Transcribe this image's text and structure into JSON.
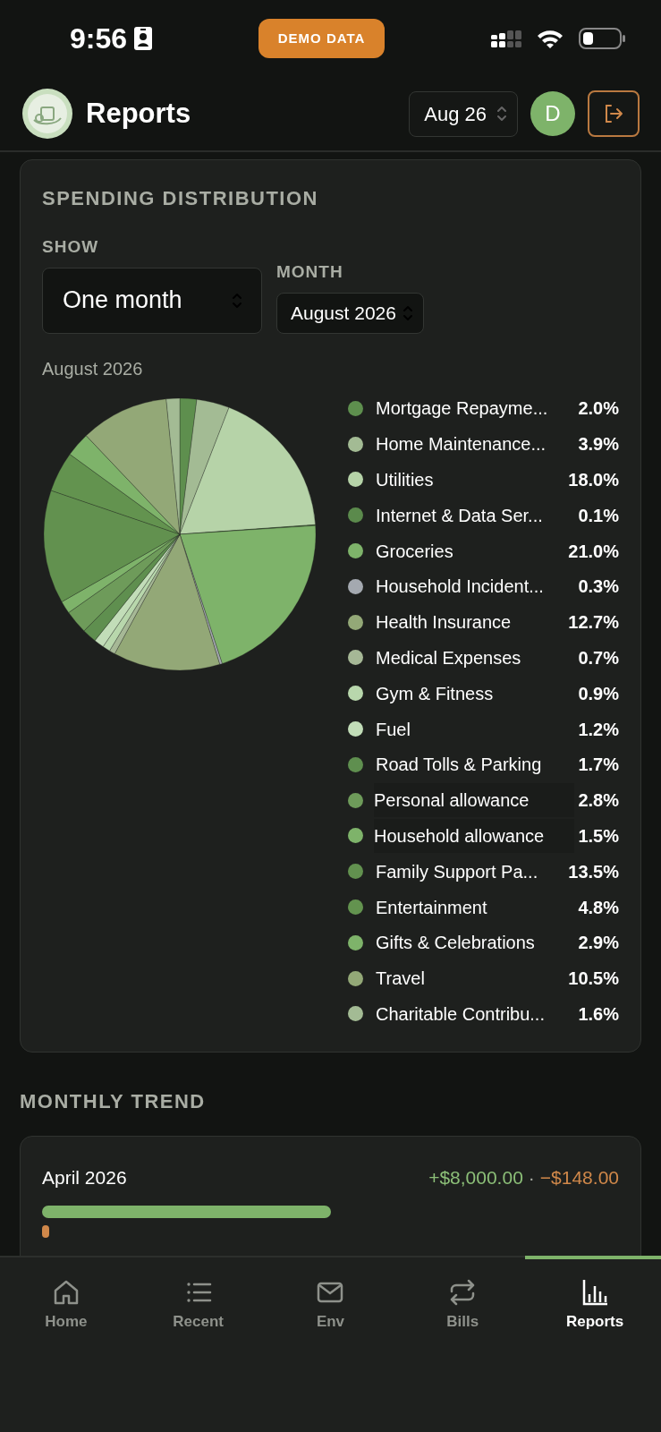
{
  "status_bar": {
    "time": "9:56",
    "badge": "DEMO DATA"
  },
  "header": {
    "title": "Reports",
    "period": "Aug 26",
    "avatar": "D"
  },
  "spending_distribution": {
    "title": "SPENDING DISTRIBUTION",
    "show": {
      "label": "SHOW",
      "value": "One month"
    },
    "month": {
      "label": "MONTH",
      "value": "August 2026"
    },
    "chart_data": {
      "type": "pie",
      "title": "August 2026",
      "categories": [
        "Mortgage Repayme...",
        "Home Maintenance...",
        "Utilities",
        "Internet & Data Ser...",
        "Groceries",
        "Household Incident...",
        "Health Insurance",
        "Medical Expenses",
        "Gym & Fitness",
        "Fuel",
        "Road Tolls & Parking",
        "Personal allowance",
        "Household allowance",
        "Family Support Pa...",
        "Entertainment",
        "Gifts & Celebrations",
        "Travel",
        "Charitable Contribu..."
      ],
      "values": [
        2.0,
        3.9,
        18.0,
        0.1,
        21.0,
        0.3,
        12.7,
        0.7,
        0.9,
        1.2,
        1.7,
        2.8,
        1.5,
        13.5,
        4.8,
        2.9,
        10.5,
        1.6
      ],
      "value_labels": [
        "2.0%",
        "3.9%",
        "18.0%",
        "0.1%",
        "21.0%",
        "0.3%",
        "12.7%",
        "0.7%",
        "0.9%",
        "1.2%",
        "1.7%",
        "2.8%",
        "1.5%",
        "13.5%",
        "4.8%",
        "2.9%",
        "10.5%",
        "1.6%"
      ],
      "colors": [
        "#5e8f4e",
        "#a3bb94",
        "#b6d3a8",
        "#5b8a4c",
        "#7eb36a",
        "#a4a9b0",
        "#93a877",
        "#a6b896",
        "#b8d7ac",
        "#c2ddb8",
        "#5f8f4f",
        "#6e9b5a",
        "#7eb36a",
        "#62914f",
        "#63934f",
        "#7eb36a",
        "#93a877",
        "#a3bb94"
      ]
    },
    "legend_rows": [
      {
        "highlighted": false
      },
      {
        "highlighted": false
      },
      {
        "highlighted": false
      },
      {
        "highlighted": false
      },
      {
        "highlighted": false
      },
      {
        "highlighted": false
      },
      {
        "highlighted": false
      },
      {
        "highlighted": false
      },
      {
        "highlighted": false
      },
      {
        "highlighted": false
      },
      {
        "highlighted": false
      },
      {
        "highlighted": true
      },
      {
        "highlighted": true
      },
      {
        "highlighted": false
      },
      {
        "highlighted": false
      },
      {
        "highlighted": false
      },
      {
        "highlighted": false
      },
      {
        "highlighted": false
      }
    ]
  },
  "monthly_trend": {
    "title": "MONTHLY TREND",
    "rows": [
      {
        "month": "April 2026",
        "income": {
          "amount": "+$8,000.00",
          "level": 0.5
        },
        "separator": "·",
        "expense": {
          "amount": "−$148.00",
          "level": 0.006
        }
      }
    ]
  },
  "nav": [
    {
      "label": "Home",
      "kind": "home",
      "selected": false
    },
    {
      "label": "Recent",
      "kind": "list",
      "selected": false
    },
    {
      "label": "Env",
      "kind": "mail",
      "selected": false
    },
    {
      "label": "Bills",
      "kind": "repeat",
      "selected": false
    },
    {
      "label": "Reports",
      "kind": "chart",
      "selected": true
    }
  ]
}
